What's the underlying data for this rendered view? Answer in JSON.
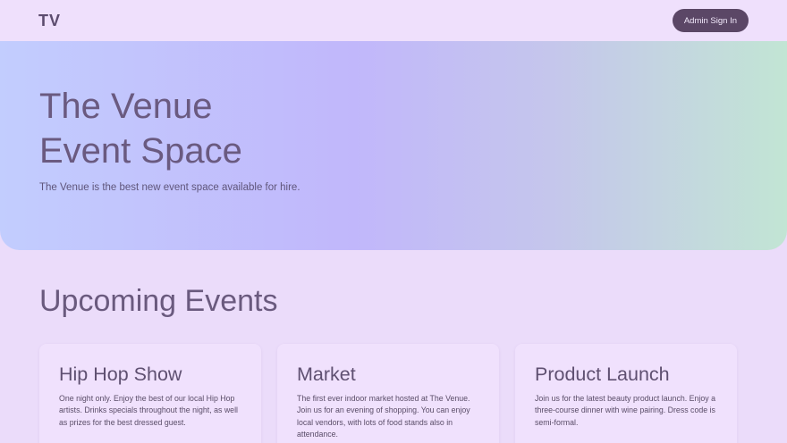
{
  "header": {
    "logo": "TV",
    "signin_label": "Admin Sign In"
  },
  "hero": {
    "title_line1": "The Venue",
    "title_line2": "Event Space",
    "subtitle": "The Venue is the best new event space available for hire."
  },
  "events": {
    "heading": "Upcoming Events",
    "items": [
      {
        "title": "Hip Hop Show",
        "description": "One night only. Enjoy the best of our local Hip Hop artists. Drinks specials throughout the night, as well as prizes for the best dressed guest."
      },
      {
        "title": "Market",
        "description": "The first ever indoor market hosted at The Venue. Join us for an evening of shopping. You can enjoy local vendors, with lots of food stands also in attendance."
      },
      {
        "title": "Product Launch",
        "description": "Join us for the latest beauty product launch. Enjoy a three-course dinner with wine pairing. Dress code is semi-formal."
      }
    ]
  },
  "colors": {
    "page_background": "#ebdcfa",
    "button_background": "#5b4766",
    "text": "#5e4e70"
  }
}
